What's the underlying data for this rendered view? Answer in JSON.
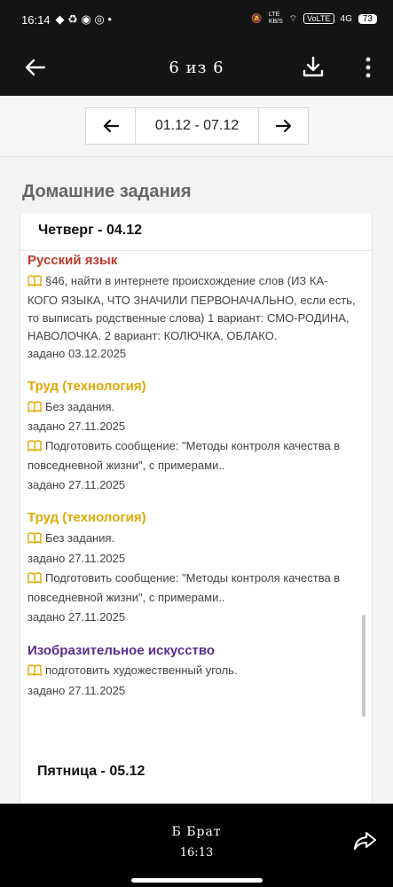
{
  "status": {
    "time": "16:14",
    "network": "LTE",
    "speed": "KB/S",
    "volte": "VoLTE",
    "signal": "4G",
    "battery": "73"
  },
  "toolbar": {
    "title": "6 из 6"
  },
  "week": {
    "range": "01.12 - 07.12"
  },
  "section_title": "Домашние задания",
  "days": [
    {
      "header": "Четверг - 04.12",
      "lessons": [
        {
          "subject": "Русский язык",
          "color": "#c0392b",
          "tasks": [
            {
              "text": "§46, найти в интернете происхождение слов (ИЗ КА-КОГО ЯЗЫКА, ЧТО ЗНАЧИЛИ ПЕРВОНАЧАЛЬНО, если есть, то выписать родственные слова) 1 вариант: СМО-РОДИНА, НАВОЛОЧКА. 2 вариант: КОЛЮЧКА, ОБЛАКО.",
              "given": "задано 03.12.2025"
            }
          ]
        },
        {
          "subject": "Труд (технология)",
          "color": "#e0a800",
          "tasks": [
            {
              "text": "Без задания.",
              "given": "задано 27.11.2025"
            },
            {
              "text": "Подготовить сообщение: \"Методы контроля качества в повседневной жизни\", с примерами..",
              "given": "задано 27.11.2025"
            }
          ]
        },
        {
          "subject": "Труд (технология)",
          "color": "#e0a800",
          "tasks": [
            {
              "text": "Без задания.",
              "given": "задано 27.11.2025"
            },
            {
              "text": "Подготовить сообщение: \"Методы контроля качества в повседневной жизни\", с примерами..",
              "given": "задано 27.11.2025"
            }
          ]
        },
        {
          "subject": "Изобразительное искусство",
          "color": "#5b2d8e",
          "tasks": [
            {
              "text": "подготовить художественный уголь.",
              "given": "задано 27.11.2025"
            }
          ]
        }
      ]
    },
    {
      "header": "Пятница - 05.12"
    }
  ],
  "footer": {
    "sender": "Б Брат",
    "time": "16:13"
  },
  "icons": {
    "back": "arrow-left-icon",
    "download": "download-icon",
    "more": "more-vert-icon",
    "book": "book-icon",
    "share": "share-icon",
    "fab": "capture-icon"
  }
}
